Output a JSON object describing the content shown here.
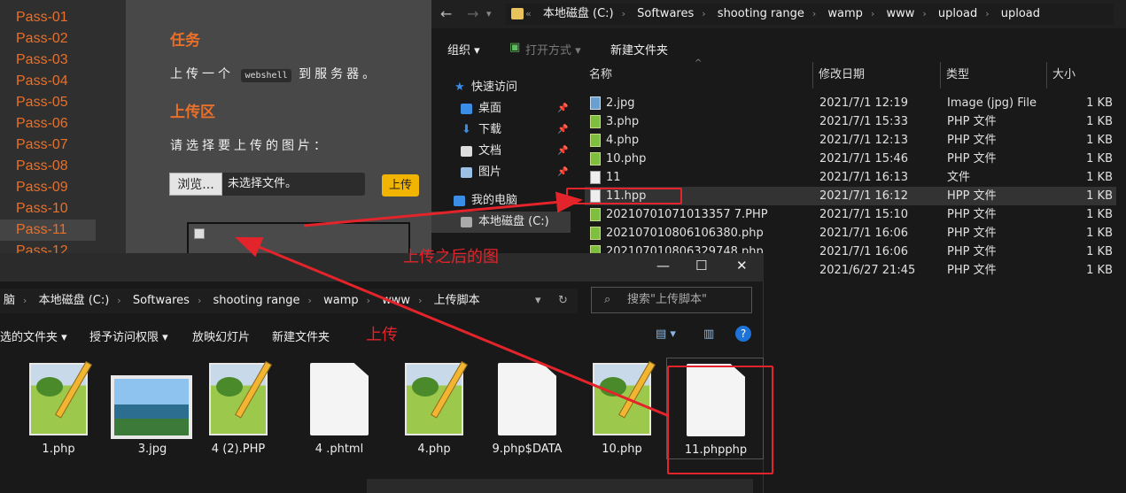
{
  "web": {
    "passes": [
      "Pass-01",
      "Pass-02",
      "Pass-03",
      "Pass-04",
      "Pass-05",
      "Pass-06",
      "Pass-07",
      "Pass-08",
      "Pass-09",
      "Pass-10",
      "Pass-11",
      "Pass-12"
    ],
    "task_title": "任务",
    "task_text_pre": "上传一个",
    "task_code": "webshell",
    "task_text_post": "到服务器。",
    "upload_title": "上传区",
    "upload_prompt": "请选择要上传的图片：",
    "browse_label": "浏览...",
    "no_file_label": "未选择文件。",
    "upload_button": "上传"
  },
  "explorer1": {
    "breadcrumbs": [
      "本地磁盘 (C:)",
      "Softwares",
      "shooting range",
      "wamp",
      "www",
      "upload",
      "upload"
    ],
    "toolbar": {
      "organize": "组织",
      "open_with": "打开方式",
      "new_folder": "新建文件夹"
    },
    "nav": {
      "quick_access": "快速访问",
      "desktop": "桌面",
      "downloads": "下载",
      "documents": "文档",
      "pictures": "图片",
      "this_pc": "我的电脑",
      "local_disk": "本地磁盘 (C:)"
    },
    "columns": {
      "name": "名称",
      "date": "修改日期",
      "type": "类型",
      "size": "大小"
    },
    "files": [
      {
        "name": "2.jpg",
        "date": "2021/7/1 12:19",
        "type": "Image (jpg) File",
        "size": "1 KB",
        "icon": "image-icon"
      },
      {
        "name": "3.php",
        "date": "2021/7/1 15:33",
        "type": "PHP 文件",
        "size": "1 KB",
        "icon": "notepad-icon"
      },
      {
        "name": "4.php",
        "date": "2021/7/1 12:13",
        "type": "PHP 文件",
        "size": "1 KB",
        "icon": "notepad-icon"
      },
      {
        "name": "10.php",
        "date": "2021/7/1 15:46",
        "type": "PHP 文件",
        "size": "1 KB",
        "icon": "notepad-icon"
      },
      {
        "name": "11",
        "date": "2021/7/1 16:13",
        "type": "文件",
        "size": "1 KB",
        "icon": "file-icon"
      },
      {
        "name": "11.hpp",
        "date": "2021/7/1 16:12",
        "type": "HPP 文件",
        "size": "1 KB",
        "icon": "file-icon"
      },
      {
        "name": "20210701071013357 7.PHP",
        "date": "2021/7/1 15:10",
        "type": "PHP 文件",
        "size": "1 KB",
        "icon": "notepad-icon"
      },
      {
        "name": "202107010806106380.php",
        "date": "2021/7/1 16:06",
        "type": "PHP 文件",
        "size": "1 KB",
        "icon": "notepad-icon"
      },
      {
        "name": "202107010806329748.php",
        "date": "2021/7/1 16:06",
        "type": "PHP 文件",
        "size": "1 KB",
        "icon": "notepad-icon"
      },
      {
        "name": "",
        "date": "2021/6/27 21:45",
        "type": "PHP 文件",
        "size": "1 KB",
        "icon": "notepad-icon"
      }
    ]
  },
  "explorer2": {
    "breadcrumbs": [
      "脑",
      "本地磁盘 (C:)",
      "Softwares",
      "shooting range",
      "wamp",
      "www",
      "上传脚本"
    ],
    "search_placeholder": "搜索\"上传脚本\"",
    "toolbar": {
      "selected": "选的文件夹",
      "grant": "授予访问权限",
      "slideshow": "放映幻灯片",
      "new_folder": "新建文件夹"
    },
    "tiles": [
      {
        "label": "1.php",
        "kind": "notepad"
      },
      {
        "label": "3.jpg",
        "kind": "image"
      },
      {
        "label": "4 (2).PHP",
        "kind": "notepad"
      },
      {
        "label": "4 .phtml",
        "kind": "doc"
      },
      {
        "label": "4.php",
        "kind": "notepad"
      },
      {
        "label": "9.php$DATA",
        "kind": "doc"
      },
      {
        "label": "10.php",
        "kind": "notepad"
      },
      {
        "label": "11.phpphp",
        "kind": "doc"
      }
    ]
  },
  "annotations": {
    "after_upload": "上传之后的图",
    "upload": "上传",
    "color": "#e3242b"
  }
}
